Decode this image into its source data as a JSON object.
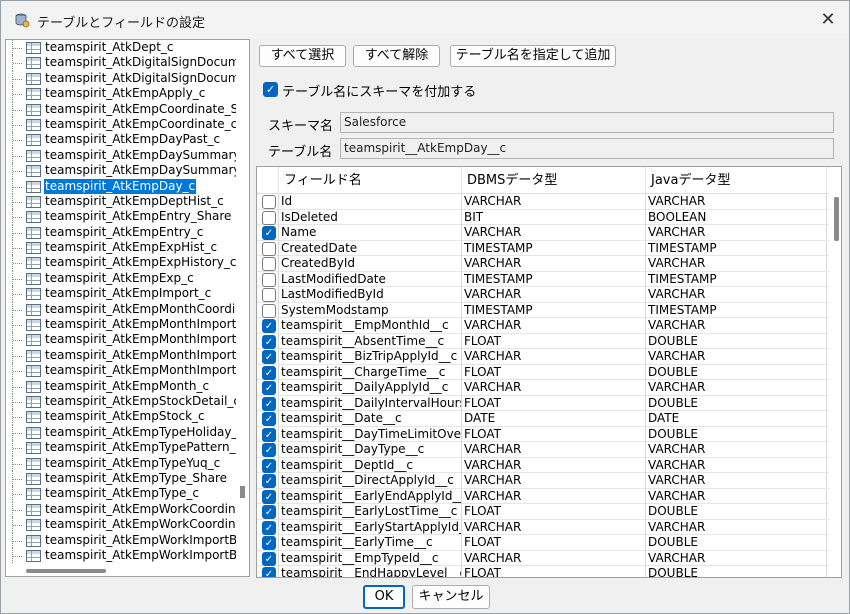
{
  "window": {
    "title": "テーブルとフィールドの設定",
    "close_glyph": "✕",
    "icon": "database-settings-icon"
  },
  "tables": [
    "teamspirit_AtkDept_c",
    "teamspirit_AtkDigitalSignDocume",
    "teamspirit_AtkDigitalSignDocume",
    "teamspirit_AtkEmpApply_c",
    "teamspirit_AtkEmpCoordinate_S",
    "teamspirit_AtkEmpCoordinate_c",
    "teamspirit_AtkEmpDayPast_c",
    "teamspirit_AtkEmpDaySummary_",
    "teamspirit_AtkEmpDaySummary_",
    "teamspirit_AtkEmpDay_c",
    "teamspirit_AtkEmpDeptHist_c",
    "teamspirit_AtkEmpEntry_Share",
    "teamspirit_AtkEmpEntry_c",
    "teamspirit_AtkEmpExpHist_c",
    "teamspirit_AtkEmpExpHistory_c",
    "teamspirit_AtkEmpExp_c",
    "teamspirit_AtkEmpImport_c",
    "teamspirit_AtkEmpMonthCoordin",
    "teamspirit_AtkEmpMonthImportE",
    "teamspirit_AtkEmpMonthImportE",
    "teamspirit_AtkEmpMonthImport_",
    "teamspirit_AtkEmpMonthImport_",
    "teamspirit_AtkEmpMonth_c",
    "teamspirit_AtkEmpStockDetail_c",
    "teamspirit_AtkEmpStock_c",
    "teamspirit_AtkEmpTypeHoliday_c",
    "teamspirit_AtkEmpTypePattern_",
    "teamspirit_AtkEmpTypeYuq_c",
    "teamspirit_AtkEmpType_Share",
    "teamspirit_AtkEmpType_c",
    "teamspirit_AtkEmpWorkCoordina",
    "teamspirit_AtkEmpWorkCoordinat",
    "teamspirit_AtkEmpWorkImportBa",
    "teamspirit_AtkEmpWorkImportBa"
  ],
  "selected_table_index": 9,
  "toolbar": {
    "select_all": "すべて選択",
    "deselect_all": "すべて解除",
    "add_by_name": "テーブル名を指定して追加"
  },
  "schema_option": {
    "label": "テーブル名にスキーマを付加する",
    "checked": true,
    "check_glyph": "✓"
  },
  "schema": {
    "label": "スキーマ名",
    "value": "Salesforce"
  },
  "table_name": {
    "label": "テーブル名",
    "value": "teamspirit__AtkEmpDay__c"
  },
  "grid": {
    "headers": {
      "field": "フィールド名",
      "dbms": "DBMSデータ型",
      "java": "Javaデータ型"
    },
    "rows": [
      {
        "checked": false,
        "field": "Id",
        "dbms": "VARCHAR",
        "java": "VARCHAR"
      },
      {
        "checked": false,
        "field": "IsDeleted",
        "dbms": "BIT",
        "java": "BOOLEAN"
      },
      {
        "checked": true,
        "field": "Name",
        "dbms": "VARCHAR",
        "java": "VARCHAR"
      },
      {
        "checked": false,
        "field": "CreatedDate",
        "dbms": "TIMESTAMP",
        "java": "TIMESTAMP"
      },
      {
        "checked": false,
        "field": "CreatedById",
        "dbms": "VARCHAR",
        "java": "VARCHAR"
      },
      {
        "checked": false,
        "field": "LastModifiedDate",
        "dbms": "TIMESTAMP",
        "java": "TIMESTAMP"
      },
      {
        "checked": false,
        "field": "LastModifiedById",
        "dbms": "VARCHAR",
        "java": "VARCHAR"
      },
      {
        "checked": false,
        "field": "SystemModstamp",
        "dbms": "TIMESTAMP",
        "java": "TIMESTAMP"
      },
      {
        "checked": true,
        "field": "teamspirit__EmpMonthId__c",
        "dbms": "VARCHAR",
        "java": "VARCHAR"
      },
      {
        "checked": true,
        "field": "teamspirit__AbsentTime__c",
        "dbms": "FLOAT",
        "java": "DOUBLE"
      },
      {
        "checked": true,
        "field": "teamspirit__BizTripApplyId__c",
        "dbms": "VARCHAR",
        "java": "VARCHAR"
      },
      {
        "checked": true,
        "field": "teamspirit__ChargeTime__c",
        "dbms": "FLOAT",
        "java": "DOUBLE"
      },
      {
        "checked": true,
        "field": "teamspirit__DailyApplyId__c",
        "dbms": "VARCHAR",
        "java": "VARCHAR"
      },
      {
        "checked": true,
        "field": "teamspirit__DailyIntervalHours_...",
        "dbms": "FLOAT",
        "java": "DOUBLE"
      },
      {
        "checked": true,
        "field": "teamspirit__Date__c",
        "dbms": "DATE",
        "java": "DATE"
      },
      {
        "checked": true,
        "field": "teamspirit__DayTimeLimitOver...",
        "dbms": "FLOAT",
        "java": "DOUBLE"
      },
      {
        "checked": true,
        "field": "teamspirit__DayType__c",
        "dbms": "VARCHAR",
        "java": "VARCHAR"
      },
      {
        "checked": true,
        "field": "teamspirit__DeptId__c",
        "dbms": "VARCHAR",
        "java": "VARCHAR"
      },
      {
        "checked": true,
        "field": "teamspirit__DirectApplyId__c",
        "dbms": "VARCHAR",
        "java": "VARCHAR"
      },
      {
        "checked": true,
        "field": "teamspirit__EarlyEndApplyId__c",
        "dbms": "VARCHAR",
        "java": "VARCHAR"
      },
      {
        "checked": true,
        "field": "teamspirit__EarlyLostTime__c",
        "dbms": "FLOAT",
        "java": "DOUBLE"
      },
      {
        "checked": true,
        "field": "teamspirit__EarlyStartApplyId__c",
        "dbms": "VARCHAR",
        "java": "VARCHAR"
      },
      {
        "checked": true,
        "field": "teamspirit__EarlyTime__c",
        "dbms": "FLOAT",
        "java": "DOUBLE"
      },
      {
        "checked": true,
        "field": "teamspirit__EmpTypeId__c",
        "dbms": "VARCHAR",
        "java": "VARCHAR"
      },
      {
        "checked": true,
        "field": "teamspirit__EndHappyLevel__c",
        "dbms": "FLOAT",
        "java": "DOUBLE"
      }
    ]
  },
  "footer": {
    "ok": "OK",
    "cancel": "キャンセル"
  },
  "colors": {
    "accent": "#0067c0",
    "selection": "#0078d7"
  }
}
